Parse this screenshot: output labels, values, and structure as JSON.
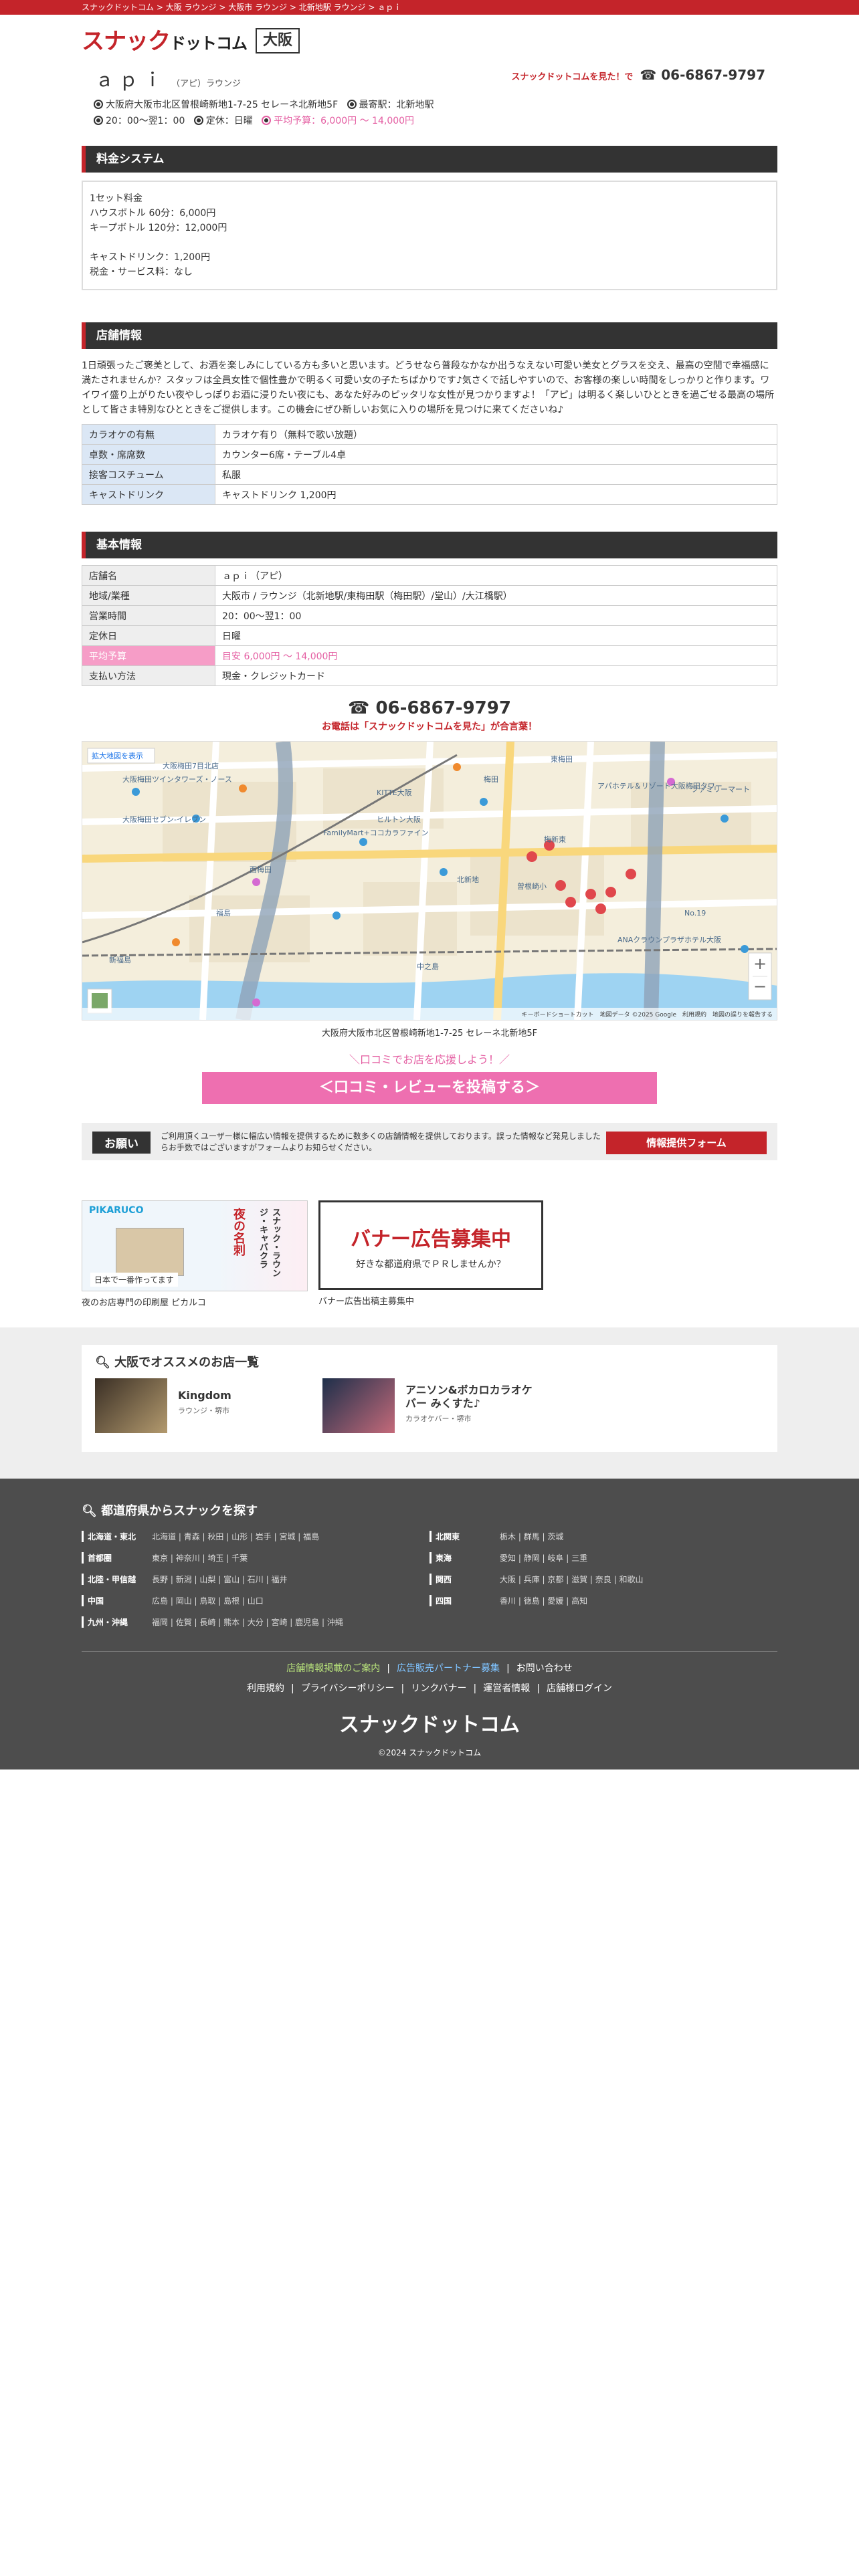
{
  "breadcrumb": [
    "スナックドットコム",
    "大阪 ラウンジ",
    "大阪市 ラウンジ",
    "北新地駅 ラウンジ",
    "ａｐｉ"
  ],
  "breadcrumb_sep": " > ",
  "header": {
    "logo_main": "スナック",
    "logo_sub": "ドットコム",
    "area": "大阪"
  },
  "shop": {
    "name": "ａｐｉ",
    "kana_type": "（アピ）ラウンジ",
    "tel_note": "スナックドットコムを見た！で",
    "tel": "☎ 06-6867-9797",
    "address": "大阪府大阪市北区曽根崎新地1-7-25 セレーネ北新地5F",
    "station": "最寄駅：北新地駅",
    "hours": "20：00〜翌1：00",
    "holiday": "定休：日曜",
    "budget": "平均予算：6,000円 〜 14,000円"
  },
  "sections": {
    "price": "料金システム",
    "shop_info": "店舗情報",
    "basic_info": "基本情報"
  },
  "price_lines": [
    "1セット料金",
    "ハウスボトル 60分：6,000円",
    "キープボトル 120分：12,000円",
    "",
    "キャストドリンク：1,200円",
    "税金・サービス料：なし"
  ],
  "description": "1日頑張ったご褒美として、お酒を楽しみにしている方も多いと思います。どうせなら普段なかなか出うなえない可愛い美女とグラスを交え、最高の空間で幸福感に満たされませんか？スタッフは全員女性で個性豊かで明るく可愛い女の子たちばかりです♪気さくで話しやすいので、お客様の楽しい時間をしっかりと作ります。ワイワイ盛り上がりたい夜やしっぽりお酒に浸りたい夜にも、あなた好みのピッタリな女性が見つかりますよ！「アピ」は明るく楽しいひとときを過ごせる最高の場所として皆さま特別なひとときをご提供します。この機会にぜひ新しいお気に入りの場所を見つけに来てくださいね♪",
  "shop_table": [
    {
      "k": "カラオケの有無",
      "v": "カラオケ有り（無料で歌い放題）"
    },
    {
      "k": "卓数・席席数",
      "v": "カウンター6席・テーブル4卓"
    },
    {
      "k": "接客コスチューム",
      "v": "私服"
    },
    {
      "k": "キャストドリンク",
      "v": "キャストドリンク 1,200円"
    }
  ],
  "basic_table": [
    {
      "k": "店舗名",
      "v": "ａｐｉ（アピ）"
    },
    {
      "k": "地域/業種",
      "v": "大阪市 / ラウンジ（北新地駅/東梅田駅（梅田駅）/堂山）/大江橋駅）"
    },
    {
      "k": "営業時間",
      "v": "20：00〜翌1：00"
    },
    {
      "k": "定休日",
      "v": "日曜"
    },
    {
      "k": "平均予算",
      "v": "目安 6,000円 〜 14,000円"
    },
    {
      "k": "支払い方法",
      "v": "現金・クレジットカード"
    }
  ],
  "tel_center": "☎ 06-6867-9797",
  "tel_center_note": "お電話は「スナックドットコムを見た」が合言葉！",
  "map": {
    "labels": [
      "大阪梅田ツインタワーズ・ノース",
      "大阪梅田7目北店",
      "KITTE大阪",
      "梅田",
      "東梅田",
      "ヒルトン大阪",
      "アパホテル＆リゾート大阪梅田タワー",
      "ファミリーマート",
      "FamilyMart+ココカラファイン",
      "西梅田",
      "北新地",
      "梅新東",
      "曽根崎小",
      "福島",
      "新福島",
      "中之島",
      "ANAクラウンプラザホテル大阪",
      "大阪梅田セブン-イレブン",
      "No.19"
    ],
    "expand": "拡大地図を表示",
    "credit": "キーボードショートカット　地図データ ©2025 Google　利用規約　地図の誤りを報告する",
    "zoom_in": "+",
    "zoom_out": "−"
  },
  "map_address": "大阪府大阪市北区曽根崎新地1-7-25 セレーネ北新地5F",
  "review_note": "＼口コミでお店を応援しよう！／",
  "review_button": "＜口コミ・レビューを投稿する＞",
  "request": {
    "label": "お願い",
    "text": "ご利用頂くユーザー様に幅広い情報を提供するために数多くの店舗情報を提供しております。誤った情報など発見しましたらお手数ではございますがフォームよりお知らせください。",
    "button": "情報提供フォーム"
  },
  "banners": [
    {
      "caption": "夜のお店専門の印刷屋 ピカルコ",
      "brand": "PIKARUCO",
      "tag": "夜の名刺",
      "slogan": "日本で一番作ってます",
      "vertical": "スナック・ラウンジ・キャバクラ"
    },
    {
      "caption": "バナー広告出稿主募集中",
      "title": "バナー広告募集中",
      "sub": "好きな都道府県でＰＲしませんか？"
    }
  ],
  "recommend": {
    "title": "大阪でオススメのお店一覧",
    "items": [
      {
        "name": "Kingdom",
        "sub": "ラウンジ・堺市"
      },
      {
        "name": "アニソン&ボカロカラオケバー みくすた♪",
        "sub": "カラオケバー・堺市"
      }
    ]
  },
  "footer": {
    "title": "都道府県からスナックを探す",
    "regions": [
      {
        "name": "北海道・東北",
        "prefs": [
          "北海道",
          "青森",
          "秋田",
          "山形",
          "岩手",
          "宮城",
          "福島"
        ]
      },
      {
        "name": "北関東",
        "prefs": [
          "栃木",
          "群馬",
          "茨城"
        ]
      },
      {
        "name": "首都圏",
        "prefs": [
          "東京",
          "神奈川",
          "埼玉",
          "千葉"
        ]
      },
      {
        "name": "東海",
        "prefs": [
          "愛知",
          "静岡",
          "岐阜",
          "三重"
        ]
      },
      {
        "name": "北陸・甲信越",
        "prefs": [
          "長野",
          "新潟",
          "山梨",
          "富山",
          "石川",
          "福井"
        ]
      },
      {
        "name": "関西",
        "prefs": [
          "大阪",
          "兵庫",
          "京都",
          "滋賀",
          "奈良",
          "和歌山"
        ]
      },
      {
        "name": "中国",
        "prefs": [
          "広島",
          "岡山",
          "鳥取",
          "島根",
          "山口"
        ]
      },
      {
        "name": "四国",
        "prefs": [
          "香川",
          "徳島",
          "愛媛",
          "高知"
        ]
      },
      {
        "name": "九州・沖縄",
        "prefs": [
          "福岡",
          "佐賀",
          "長崎",
          "熊本",
          "大分",
          "宮崎",
          "鹿児島",
          "沖縄"
        ]
      }
    ],
    "links1": [
      "店舗情報掲載のご案内",
      "広告販売パートナー募集",
      "お問い合わせ"
    ],
    "links2": [
      "利用規約",
      "プライバシーポリシー",
      "リンクバナー",
      "運営者情報",
      "店舗様ログイン"
    ],
    "logo": "スナックドットコム",
    "copyright": "©2024 スナックドットコム"
  }
}
